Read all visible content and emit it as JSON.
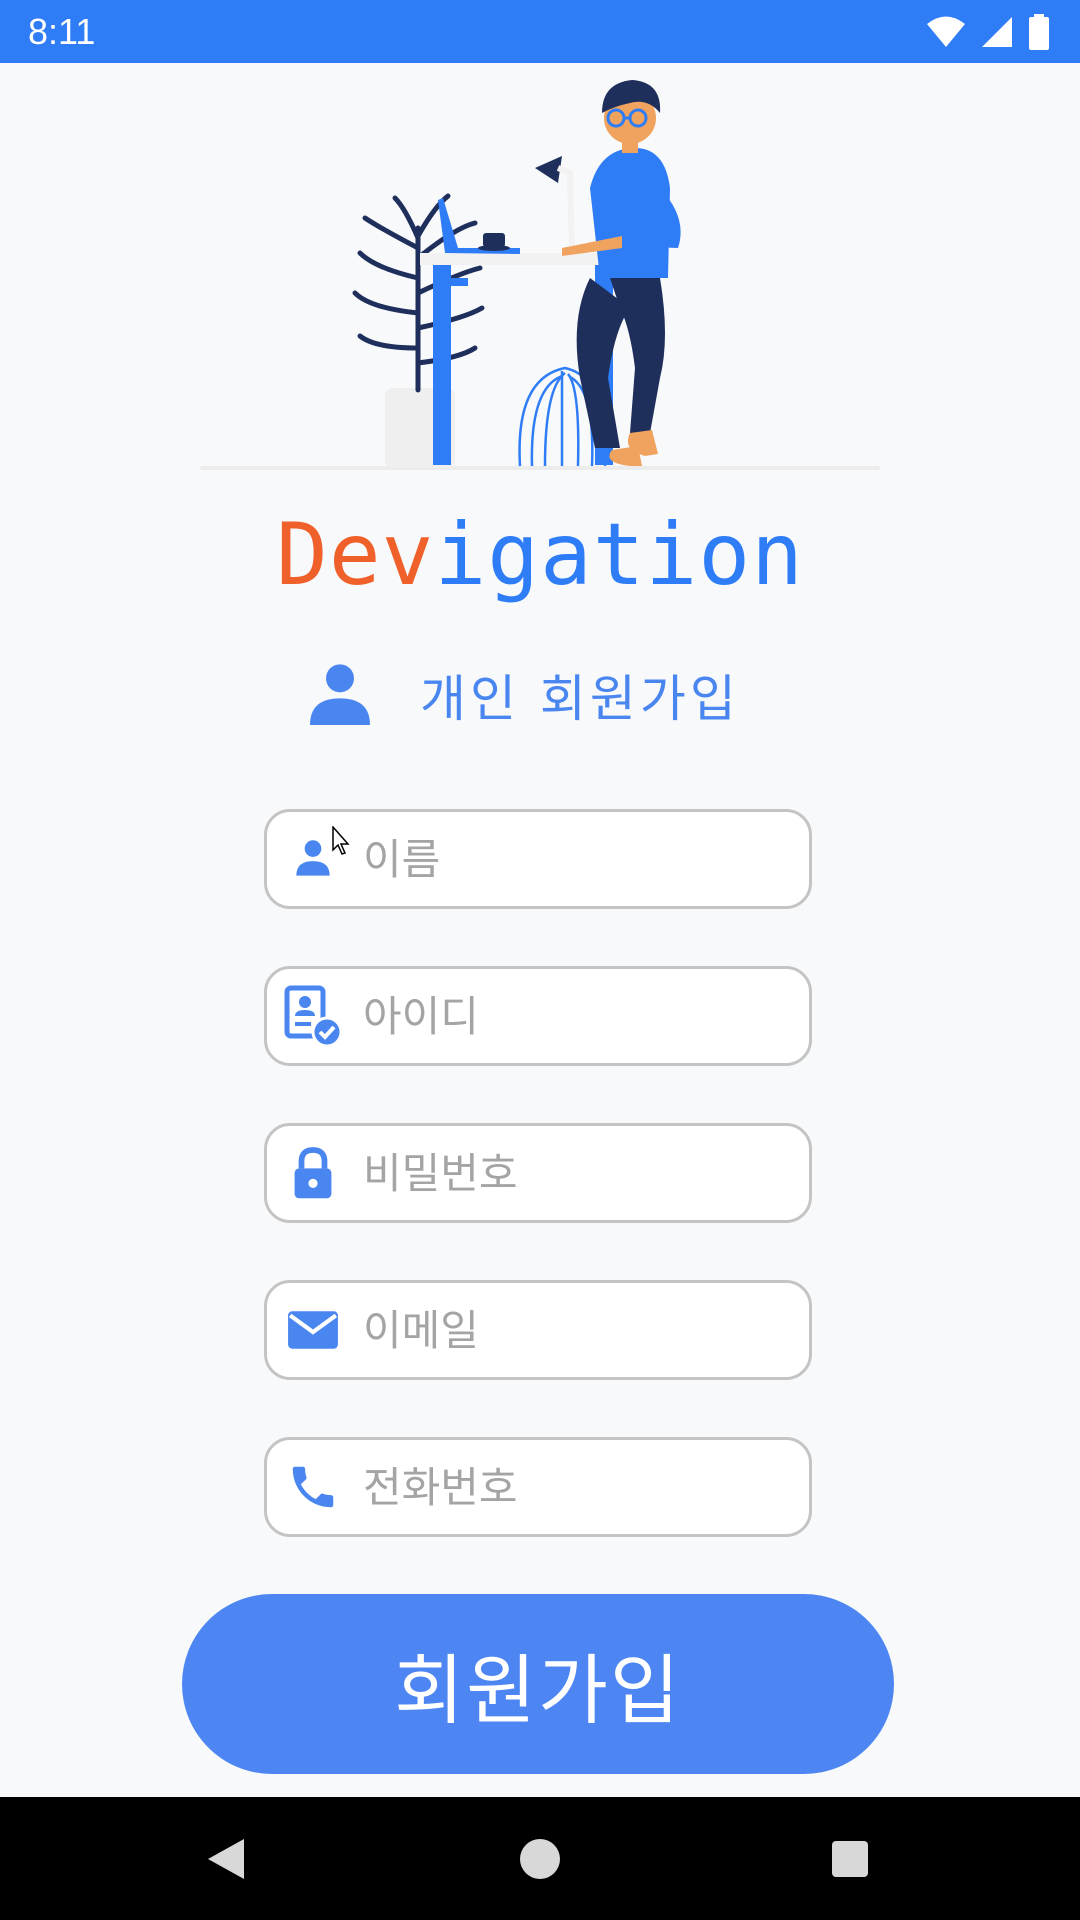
{
  "status_bar": {
    "time": "8:11",
    "icons": [
      "wifi-icon",
      "cellular-signal-icon",
      "battery-icon"
    ]
  },
  "brand": {
    "part_a": "Dev",
    "part_b": "igation",
    "color_a": "#f0602a",
    "color_b": "#2f7df6"
  },
  "section": {
    "icon": "person-icon",
    "title": "개인 회원가입"
  },
  "form": {
    "name": {
      "icon": "person-icon",
      "placeholder": "이름"
    },
    "user_id": {
      "icon": "id-badge-check-icon",
      "placeholder": "아이디"
    },
    "password": {
      "icon": "lock-icon",
      "placeholder": "비밀번호"
    },
    "email": {
      "icon": "mail-icon",
      "placeholder": "이메일"
    },
    "phone": {
      "icon": "phone-icon",
      "placeholder": "전화번호"
    }
  },
  "signup_button": {
    "label": "회원가입"
  },
  "nav_bar": {
    "items": [
      "back-icon",
      "home-icon",
      "recents-icon"
    ]
  },
  "colors": {
    "accent": "#2f7df6",
    "button": "#4d86f2",
    "field_border": "#c4c4c4",
    "placeholder": "#a4a4a4"
  }
}
